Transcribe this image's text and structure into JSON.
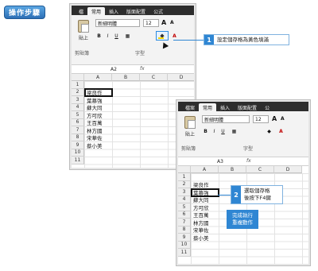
{
  "header": {
    "title": "操作步驟"
  },
  "window_a": {
    "tabs": [
      "檔",
      "常用",
      "插入",
      "版面配置",
      "公式"
    ],
    "active_tab": "常用",
    "paste_label": "貼上",
    "clipboard_label": "剪貼簿",
    "font_label": "字型",
    "font_name": "新細明體",
    "font_size": "12",
    "name_box": "A2",
    "fx": "fx",
    "columns": [
      "A",
      "B",
      "C",
      "D"
    ],
    "rows": [
      "1",
      "2",
      "3",
      "4",
      "5",
      "6",
      "7",
      "8",
      "9",
      "10",
      "11"
    ],
    "cells": [
      "",
      "梁良作",
      "葉慕強",
      "蘇大同",
      "方可欣",
      "王百萬",
      "林方國",
      "宋華佐",
      "蔡小美",
      "",
      ""
    ]
  },
  "window_b": {
    "tabs": [
      "檔案",
      "常用",
      "插入",
      "版面配置",
      "公"
    ],
    "active_tab": "常用",
    "paste_label": "貼上",
    "clipboard_label": "剪貼簿",
    "font_label": "字型",
    "font_name": "新細明體",
    "font_size": "12",
    "name_box": "A3",
    "fx": "fx",
    "columns": [
      "A",
      "B",
      "C",
      "D"
    ],
    "rows": [
      "1",
      "2",
      "3",
      "4",
      "5",
      "6",
      "7",
      "8",
      "9",
      "10",
      "11"
    ],
    "cells": [
      "",
      "梁良作",
      "葉慕強",
      "蘇大同",
      "方可欣",
      "王百萬",
      "林方國",
      "宋華佐",
      "蔡小美",
      "",
      ""
    ]
  },
  "callouts": [
    {
      "number": "1",
      "text": "設定儲存格為黃色填滿"
    },
    {
      "number": "2",
      "text_line1": "選取儲存格",
      "text_line2": "後按下F4鍵"
    }
  ],
  "done": {
    "line1": "完成執行",
    "line2": "重複動作"
  },
  "colors": {
    "accent": "#2f86d3",
    "fill_yellow": "#f5d400"
  }
}
